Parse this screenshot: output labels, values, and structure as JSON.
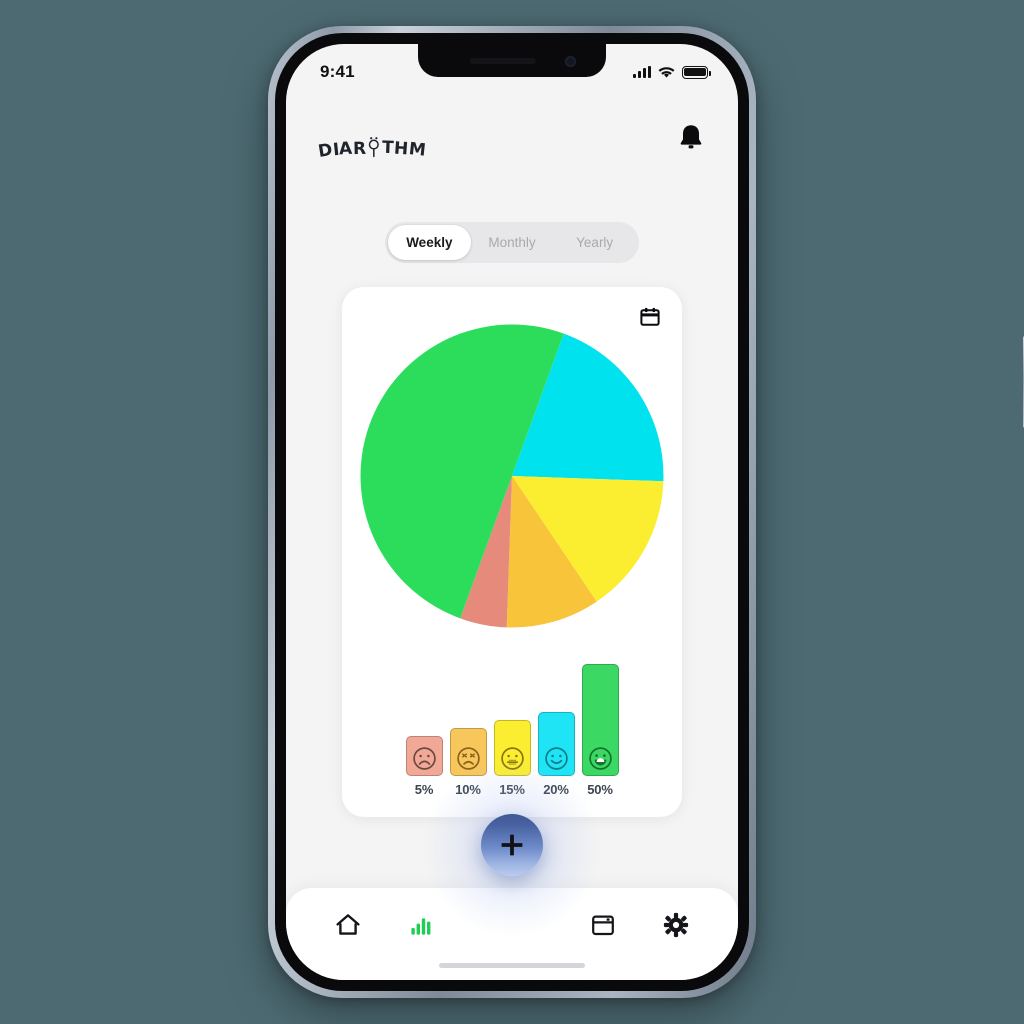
{
  "background_color": "#4d6a72",
  "status_bar": {
    "time": "9:41",
    "signal_icon": "cellular-signal-icon",
    "wifi_icon": "wifi-icon",
    "battery_icon": "battery-full-icon"
  },
  "header": {
    "logo_text": "DIARYTHM",
    "logo_letters": [
      "D",
      "I",
      "A",
      "R",
      "Y",
      "T",
      "H",
      "M"
    ],
    "notification_icon": "bell-icon"
  },
  "tabs": {
    "items": [
      {
        "label": "Weekly",
        "active": true
      },
      {
        "label": "Monthly",
        "active": false
      },
      {
        "label": "Yearly",
        "active": false
      }
    ]
  },
  "card": {
    "calendar_icon": "calendar-icon"
  },
  "chart_data": [
    {
      "type": "pie",
      "title": "",
      "start_angle_deg": 0,
      "direction": "clockwise",
      "categories": [
        "Great",
        "Good",
        "Okay",
        "Bad",
        "Awful"
      ],
      "labels": [
        "Great (green)",
        "Good (cyan)",
        "Okay (yellow)",
        "Bad (orange)",
        "Awful (salmon)"
      ],
      "values": [
        50,
        20,
        15,
        10,
        5
      ],
      "colors": [
        "#2cdd5c",
        "#00e2ee",
        "#fbee30",
        "#f8c43a",
        "#e68b7c"
      ],
      "slice_order_clockwise_from_top": [
        {
          "label": "Great",
          "value": 50,
          "color": "#2cdd5c",
          "span_deg": 20
        },
        {
          "label": "Good",
          "value": 20,
          "color": "#00e2ee",
          "span_deg": 72
        },
        {
          "label": "Okay",
          "value": 15,
          "color": "#fbee30",
          "span_deg": 54
        },
        {
          "label": "Bad",
          "value": 10,
          "color": "#f8c43a",
          "span_deg": 36
        },
        {
          "label": "Awful",
          "value": 5,
          "color": "#e68b7c",
          "span_deg": 18
        },
        {
          "label": "Great",
          "value": 0,
          "color": "#2cdd5c",
          "span_deg": 160
        }
      ],
      "legend_position": "none",
      "grid": false
    },
    {
      "type": "bar",
      "title": "",
      "xlabel": "",
      "ylabel": "",
      "ylim": [
        0,
        50
      ],
      "categories": [
        "5%",
        "10%",
        "15%",
        "20%",
        "50%"
      ],
      "values": [
        5,
        10,
        15,
        20,
        50
      ],
      "tick_labels": [
        "5%",
        "10%",
        "15%",
        "20%",
        "50%"
      ],
      "colors": [
        "#f2a897",
        "#f7c75c",
        "#fbee30",
        "#1fe4f5",
        "#3bd964"
      ],
      "face_icons": [
        "sad-face-icon",
        "frowning-face-icon",
        "neutral-face-icon",
        "smiling-face-icon",
        "grinning-face-icon"
      ],
      "bars": [
        {
          "label": "5%",
          "value": 5,
          "color": "#f2a897",
          "face": "sad-face-icon"
        },
        {
          "label": "10%",
          "value": 10,
          "color": "#f7c75c",
          "face": "frowning-face-icon"
        },
        {
          "label": "15%",
          "value": 15,
          "color": "#fbee30",
          "face": "neutral-face-icon"
        },
        {
          "label": "20%",
          "value": 20,
          "color": "#1fe4f5",
          "face": "smiling-face-icon"
        },
        {
          "label": "50%",
          "value": 50,
          "color": "#3bd964",
          "face": "grinning-face-icon"
        }
      ],
      "grid": false,
      "legend_position": "none"
    }
  ],
  "fab": {
    "icon": "plus-icon",
    "color": "#5a78bd"
  },
  "bottom_nav": {
    "items": [
      {
        "name": "home",
        "icon": "home-icon",
        "active": false,
        "color": "#14161a"
      },
      {
        "name": "stats",
        "icon": "bar-chart-icon",
        "active": true,
        "color": "#22cc55"
      },
      {
        "name": "calendar",
        "icon": "calendar-icon",
        "active": false,
        "color": "#14161a"
      },
      {
        "name": "settings",
        "icon": "gear-icon",
        "active": false,
        "color": "#14161a"
      }
    ]
  }
}
